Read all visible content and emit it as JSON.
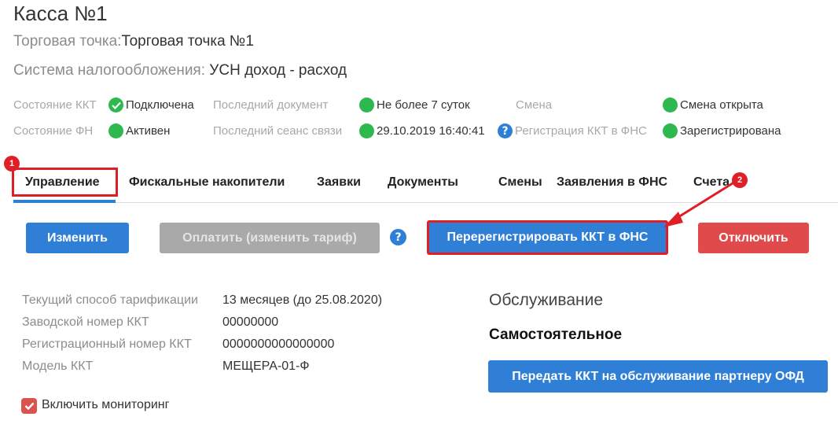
{
  "header": {
    "title": "Касса №1",
    "outlet_label": "Торговая точка:",
    "outlet_value": "Торговая точка №1",
    "tax_label": "Система налогообложения: ",
    "tax_value": "УСН доход - расход"
  },
  "status": {
    "kkt_state_label": "Состояние ККТ",
    "kkt_state_value": "Подключена",
    "last_doc_label": "Последний документ",
    "last_doc_value": "Не более 7 суток",
    "shift_label": "Смена",
    "shift_value": "Смена открыта",
    "fn_state_label": "Состояние ФН",
    "fn_state_value": "Активен",
    "last_session_label": "Последний сеанс связи",
    "last_session_value": "29.10.2019 16:40:41",
    "fns_reg_label": "Регистрация ККТ в ФНС",
    "fns_reg_value": "Зарегистрирована",
    "status_color": "#2db94d"
  },
  "tabs": [
    {
      "label": "Управление"
    },
    {
      "label": "Фискальные накопители"
    },
    {
      "label": "Заявки"
    },
    {
      "label": "Документы"
    },
    {
      "label": "Смены"
    },
    {
      "label": "Заявления в ФНС"
    },
    {
      "label": "Счета"
    }
  ],
  "annotations": {
    "badge1": "1",
    "badge2": "2",
    "highlight_color": "#e01e26"
  },
  "actions": {
    "edit": "Изменить",
    "pay": "Оплатить (изменить тариф)",
    "reregister": "Перерегистрировать ККТ в ФНС",
    "disable": "Отключить",
    "help_glyph": "?"
  },
  "info": [
    {
      "label": "Текущий способ тарификации",
      "value": "13 месяцев (до 25.08.2020)"
    },
    {
      "label": "Заводской номер ККТ",
      "value": "00000000"
    },
    {
      "label": "Регистрационный номер ККТ",
      "value": "0000000000000000"
    },
    {
      "label": "Модель ККТ",
      "value": "МЕЩЕРА-01-Ф"
    }
  ],
  "service": {
    "title": "Обслуживание",
    "mode": "Самостоятельное",
    "transfer_button": "Передать ККТ на обслуживание партнеру ОФД"
  },
  "monitoring": {
    "label": "Включить мониторинг",
    "checked": true
  },
  "colors": {
    "accent": "#2f7fd6",
    "danger": "#e04a4a",
    "disabled": "#a9a9a9"
  }
}
